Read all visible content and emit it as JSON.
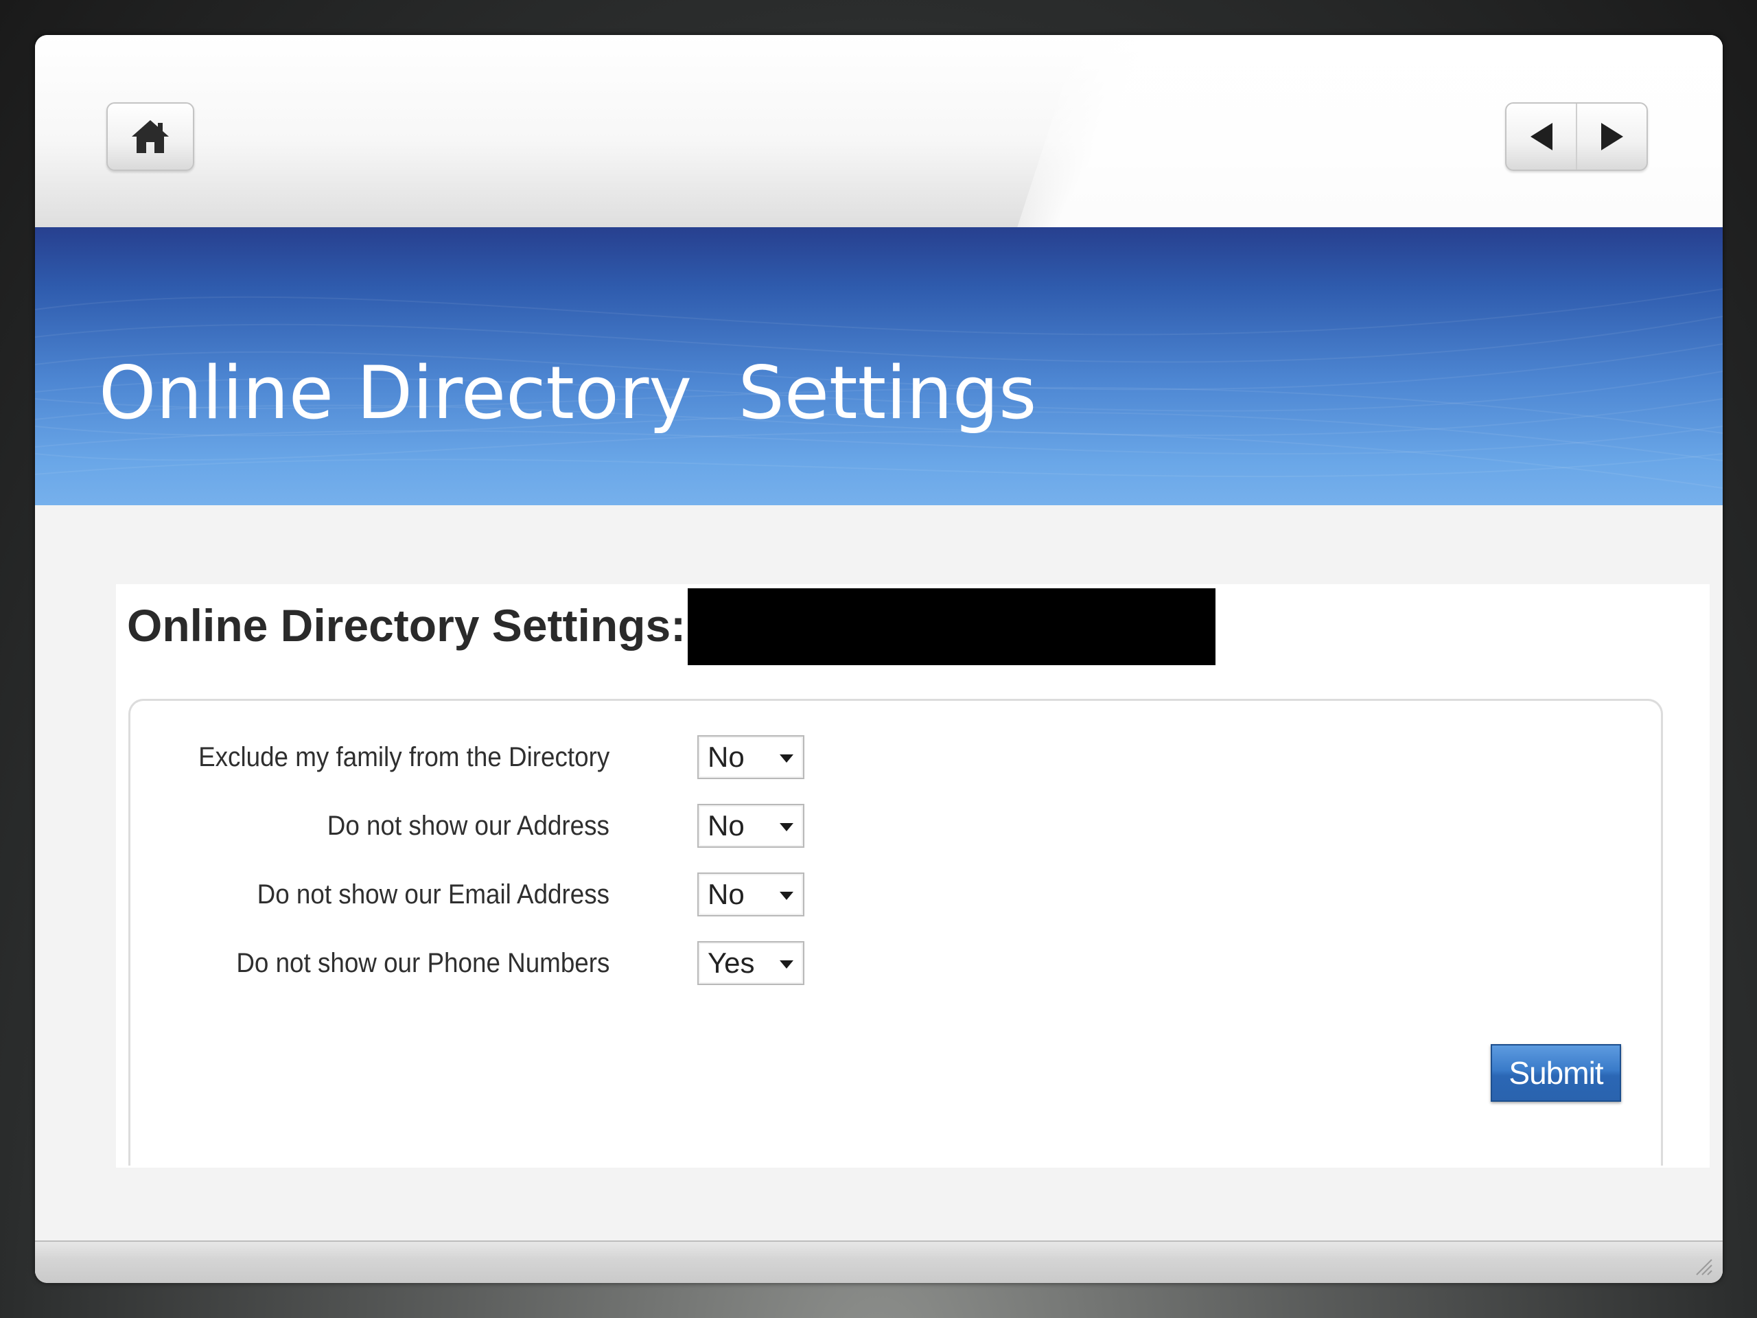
{
  "toolbar": {
    "home_icon": "home-icon",
    "prev_icon": "triangle-left-icon",
    "next_icon": "triangle-right-icon"
  },
  "banner": {
    "title": "Online Directory  Settings"
  },
  "content": {
    "heading": "Online Directory Settings:"
  },
  "form": {
    "rows": [
      {
        "label": "Exclude my family from the Directory",
        "value": "No"
      },
      {
        "label": "Do not show our Address",
        "value": "No"
      },
      {
        "label": "Do not show our Email Address",
        "value": "No"
      },
      {
        "label": "Do not show our Phone Numbers",
        "value": "Yes"
      }
    ],
    "submit_label": "Submit"
  },
  "colors": {
    "banner_top": "#27408f",
    "banner_bottom": "#76b0ec",
    "submit": "#3a7bc9",
    "heading_text": "#2a2a2a"
  }
}
